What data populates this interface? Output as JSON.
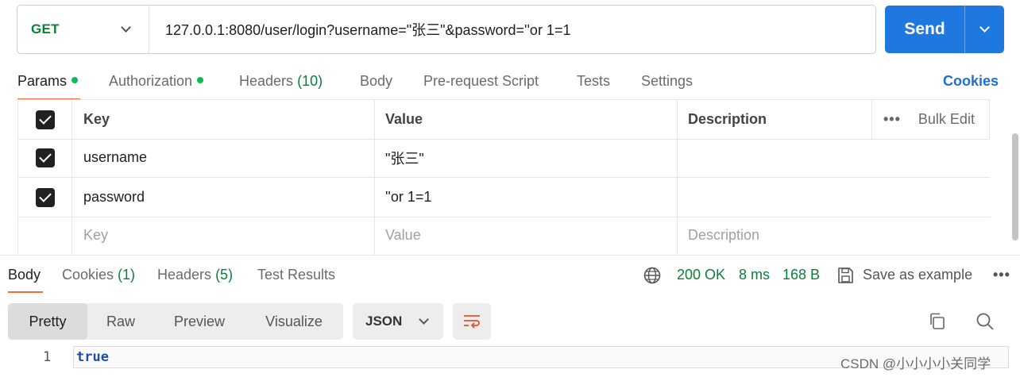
{
  "request": {
    "method": "GET",
    "url": "127.0.0.1:8080/user/login?username=\"张三\"&password=''or 1=1",
    "send_label": "Send"
  },
  "request_tabs": {
    "params": "Params",
    "authorization": "Authorization",
    "headers": "Headers",
    "headers_count": "(10)",
    "body": "Body",
    "pre_request": "Pre-request Script",
    "tests": "Tests",
    "settings": "Settings",
    "cookies": "Cookies"
  },
  "params_table": {
    "header": {
      "key": "Key",
      "value": "Value",
      "description": "Description",
      "bulk_edit": "Bulk Edit",
      "more": "•••"
    },
    "rows": [
      {
        "checked": true,
        "key": "username",
        "value": "\"张三\"",
        "description": ""
      },
      {
        "checked": true,
        "key": "password",
        "value": "''or 1=1",
        "description": ""
      }
    ],
    "placeholders": {
      "key": "Key",
      "value": "Value",
      "description": "Description"
    }
  },
  "response_tabs": {
    "body": "Body",
    "cookies": "Cookies",
    "cookies_count": "(1)",
    "headers": "Headers",
    "headers_count": "(5)",
    "test_results": "Test Results"
  },
  "response_status": {
    "status": "200 OK",
    "time": "8 ms",
    "size": "168 B",
    "save_example": "Save as example",
    "more": "•••"
  },
  "response_view": {
    "modes": [
      "Pretty",
      "Raw",
      "Preview",
      "Visualize"
    ],
    "active_mode": "Pretty",
    "format": "JSON"
  },
  "response_body": {
    "line_number": "1",
    "content": "true"
  },
  "watermark": "CSDN @小小小小关同学",
  "colors": {
    "accent": "#1f77e0",
    "method": "#0a7f3a",
    "tab_underline": "#f26b3a",
    "status_ok": "#0a7f3a"
  }
}
